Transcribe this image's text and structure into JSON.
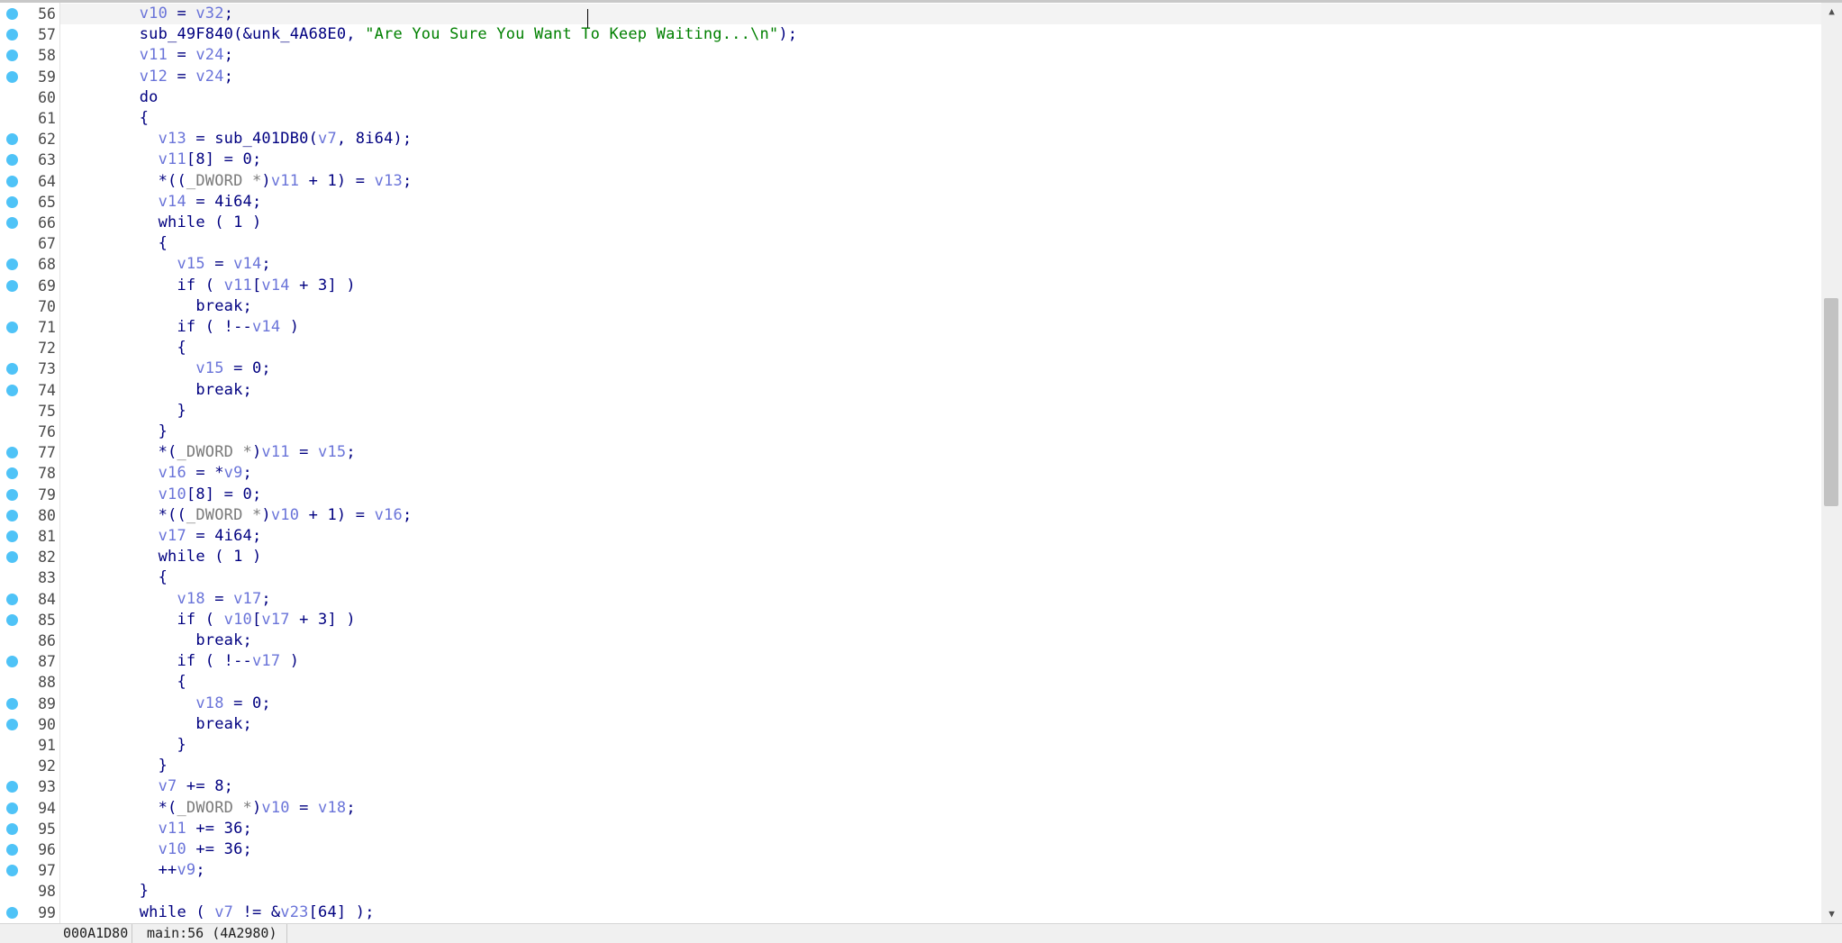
{
  "editor": {
    "current_line": "56",
    "lines": [
      {
        "num": "56",
        "bp": true,
        "tokens": [
          [
            "    ",
            "plain"
          ],
          [
            "v10",
            "var"
          ],
          [
            " = ",
            "plain"
          ],
          [
            "v32",
            "var"
          ],
          [
            ";",
            "plain"
          ]
        ]
      },
      {
        "num": "57",
        "bp": true,
        "tokens": [
          [
            "    sub_49F840(&unk_4A68E0, ",
            "plain"
          ],
          [
            "\"Are You Sure You Want To Keep Waiting...\\n\"",
            "str"
          ],
          [
            ");",
            "plain"
          ]
        ]
      },
      {
        "num": "58",
        "bp": true,
        "tokens": [
          [
            "    ",
            "plain"
          ],
          [
            "v11",
            "var"
          ],
          [
            " = ",
            "plain"
          ],
          [
            "v24",
            "var"
          ],
          [
            ";",
            "plain"
          ]
        ]
      },
      {
        "num": "59",
        "bp": true,
        "tokens": [
          [
            "    ",
            "plain"
          ],
          [
            "v12",
            "var"
          ],
          [
            " = ",
            "plain"
          ],
          [
            "v24",
            "var"
          ],
          [
            ";",
            "plain"
          ]
        ]
      },
      {
        "num": "60",
        "bp": false,
        "tokens": [
          [
            "    do",
            "plain"
          ]
        ]
      },
      {
        "num": "61",
        "bp": false,
        "tokens": [
          [
            "    {",
            "plain"
          ]
        ]
      },
      {
        "num": "62",
        "bp": true,
        "tokens": [
          [
            "      ",
            "plain"
          ],
          [
            "v13",
            "var"
          ],
          [
            " = sub_401DB0(",
            "plain"
          ],
          [
            "v7",
            "var"
          ],
          [
            ", 8i64);",
            "plain"
          ]
        ]
      },
      {
        "num": "63",
        "bp": true,
        "tokens": [
          [
            "      ",
            "plain"
          ],
          [
            "v11",
            "var"
          ],
          [
            "[8] = 0;",
            "plain"
          ]
        ]
      },
      {
        "num": "64",
        "bp": true,
        "tokens": [
          [
            "      *((",
            "plain"
          ],
          [
            "_DWORD *",
            "cast"
          ],
          [
            ")",
            "plain"
          ],
          [
            "v11",
            "var"
          ],
          [
            " + 1) = ",
            "plain"
          ],
          [
            "v13",
            "var"
          ],
          [
            ";",
            "plain"
          ]
        ]
      },
      {
        "num": "65",
        "bp": true,
        "tokens": [
          [
            "      ",
            "plain"
          ],
          [
            "v14",
            "var"
          ],
          [
            " = 4i64;",
            "plain"
          ]
        ]
      },
      {
        "num": "66",
        "bp": true,
        "tokens": [
          [
            "      while ( 1 )",
            "plain"
          ]
        ]
      },
      {
        "num": "67",
        "bp": false,
        "tokens": [
          [
            "      {",
            "plain"
          ]
        ]
      },
      {
        "num": "68",
        "bp": true,
        "tokens": [
          [
            "        ",
            "plain"
          ],
          [
            "v15",
            "var"
          ],
          [
            " = ",
            "plain"
          ],
          [
            "v14",
            "var"
          ],
          [
            ";",
            "plain"
          ]
        ]
      },
      {
        "num": "69",
        "bp": true,
        "tokens": [
          [
            "        if ( ",
            "plain"
          ],
          [
            "v11",
            "var"
          ],
          [
            "[",
            "plain"
          ],
          [
            "v14",
            "var"
          ],
          [
            " + 3] )",
            "plain"
          ]
        ]
      },
      {
        "num": "70",
        "bp": false,
        "tokens": [
          [
            "          break;",
            "plain"
          ]
        ]
      },
      {
        "num": "71",
        "bp": true,
        "tokens": [
          [
            "        if ( !--",
            "plain"
          ],
          [
            "v14",
            "var"
          ],
          [
            " )",
            "plain"
          ]
        ]
      },
      {
        "num": "72",
        "bp": false,
        "tokens": [
          [
            "        {",
            "plain"
          ]
        ]
      },
      {
        "num": "73",
        "bp": true,
        "tokens": [
          [
            "          ",
            "plain"
          ],
          [
            "v15",
            "var"
          ],
          [
            " = 0;",
            "plain"
          ]
        ]
      },
      {
        "num": "74",
        "bp": true,
        "tokens": [
          [
            "          break;",
            "plain"
          ]
        ]
      },
      {
        "num": "75",
        "bp": false,
        "tokens": [
          [
            "        }",
            "plain"
          ]
        ]
      },
      {
        "num": "76",
        "bp": false,
        "tokens": [
          [
            "      }",
            "plain"
          ]
        ]
      },
      {
        "num": "77",
        "bp": true,
        "tokens": [
          [
            "      *(",
            "plain"
          ],
          [
            "_DWORD *",
            "cast"
          ],
          [
            ")",
            "plain"
          ],
          [
            "v11",
            "var"
          ],
          [
            " = ",
            "plain"
          ],
          [
            "v15",
            "var"
          ],
          [
            ";",
            "plain"
          ]
        ]
      },
      {
        "num": "78",
        "bp": true,
        "tokens": [
          [
            "      ",
            "plain"
          ],
          [
            "v16",
            "var"
          ],
          [
            " = *",
            "plain"
          ],
          [
            "v9",
            "var"
          ],
          [
            ";",
            "plain"
          ]
        ]
      },
      {
        "num": "79",
        "bp": true,
        "tokens": [
          [
            "      ",
            "plain"
          ],
          [
            "v10",
            "var"
          ],
          [
            "[8] = 0;",
            "plain"
          ]
        ]
      },
      {
        "num": "80",
        "bp": true,
        "tokens": [
          [
            "      *((",
            "plain"
          ],
          [
            "_DWORD *",
            "cast"
          ],
          [
            ")",
            "plain"
          ],
          [
            "v10",
            "var"
          ],
          [
            " + 1) = ",
            "plain"
          ],
          [
            "v16",
            "var"
          ],
          [
            ";",
            "plain"
          ]
        ]
      },
      {
        "num": "81",
        "bp": true,
        "tokens": [
          [
            "      ",
            "plain"
          ],
          [
            "v17",
            "var"
          ],
          [
            " = 4i64;",
            "plain"
          ]
        ]
      },
      {
        "num": "82",
        "bp": true,
        "tokens": [
          [
            "      while ( 1 )",
            "plain"
          ]
        ]
      },
      {
        "num": "83",
        "bp": false,
        "tokens": [
          [
            "      {",
            "plain"
          ]
        ]
      },
      {
        "num": "84",
        "bp": true,
        "tokens": [
          [
            "        ",
            "plain"
          ],
          [
            "v18",
            "var"
          ],
          [
            " = ",
            "plain"
          ],
          [
            "v17",
            "var"
          ],
          [
            ";",
            "plain"
          ]
        ]
      },
      {
        "num": "85",
        "bp": true,
        "tokens": [
          [
            "        if ( ",
            "plain"
          ],
          [
            "v10",
            "var"
          ],
          [
            "[",
            "plain"
          ],
          [
            "v17",
            "var"
          ],
          [
            " + 3] )",
            "plain"
          ]
        ]
      },
      {
        "num": "86",
        "bp": false,
        "tokens": [
          [
            "          break;",
            "plain"
          ]
        ]
      },
      {
        "num": "87",
        "bp": true,
        "tokens": [
          [
            "        if ( !--",
            "plain"
          ],
          [
            "v17",
            "var"
          ],
          [
            " )",
            "plain"
          ]
        ]
      },
      {
        "num": "88",
        "bp": false,
        "tokens": [
          [
            "        {",
            "plain"
          ]
        ]
      },
      {
        "num": "89",
        "bp": true,
        "tokens": [
          [
            "          ",
            "plain"
          ],
          [
            "v18",
            "var"
          ],
          [
            " = 0;",
            "plain"
          ]
        ]
      },
      {
        "num": "90",
        "bp": true,
        "tokens": [
          [
            "          break;",
            "plain"
          ]
        ]
      },
      {
        "num": "91",
        "bp": false,
        "tokens": [
          [
            "        }",
            "plain"
          ]
        ]
      },
      {
        "num": "92",
        "bp": false,
        "tokens": [
          [
            "      }",
            "plain"
          ]
        ]
      },
      {
        "num": "93",
        "bp": true,
        "tokens": [
          [
            "      ",
            "plain"
          ],
          [
            "v7",
            "var"
          ],
          [
            " += 8;",
            "plain"
          ]
        ]
      },
      {
        "num": "94",
        "bp": true,
        "tokens": [
          [
            "      *(",
            "plain"
          ],
          [
            "_DWORD *",
            "cast"
          ],
          [
            ")",
            "plain"
          ],
          [
            "v10",
            "var"
          ],
          [
            " = ",
            "plain"
          ],
          [
            "v18",
            "var"
          ],
          [
            ";",
            "plain"
          ]
        ]
      },
      {
        "num": "95",
        "bp": true,
        "tokens": [
          [
            "      ",
            "plain"
          ],
          [
            "v11",
            "var"
          ],
          [
            " += 36;",
            "plain"
          ]
        ]
      },
      {
        "num": "96",
        "bp": true,
        "tokens": [
          [
            "      ",
            "plain"
          ],
          [
            "v10",
            "var"
          ],
          [
            " += 36;",
            "plain"
          ]
        ]
      },
      {
        "num": "97",
        "bp": true,
        "tokens": [
          [
            "      ++",
            "plain"
          ],
          [
            "v9",
            "var"
          ],
          [
            ";",
            "plain"
          ]
        ]
      },
      {
        "num": "98",
        "bp": false,
        "tokens": [
          [
            "    }",
            "plain"
          ]
        ]
      },
      {
        "num": "99",
        "bp": true,
        "tokens": [
          [
            "    while ( ",
            "plain"
          ],
          [
            "v7",
            "var"
          ],
          [
            " != &",
            "plain"
          ],
          [
            "v23",
            "var"
          ],
          [
            "[64] );",
            "plain"
          ]
        ]
      }
    ]
  },
  "scrollbar": {
    "up_icon": "▲",
    "down_icon": "▼",
    "thumb_start_fraction": 0.314,
    "thumb_size_fraction": 0.235
  },
  "status": {
    "address": "000A1D80",
    "location": "main:56 (4A2980)"
  },
  "colors": {
    "breakpoint": "#4fc3f7",
    "variable": "#6a74d9",
    "string": "#008000",
    "keyword": "#000080"
  }
}
